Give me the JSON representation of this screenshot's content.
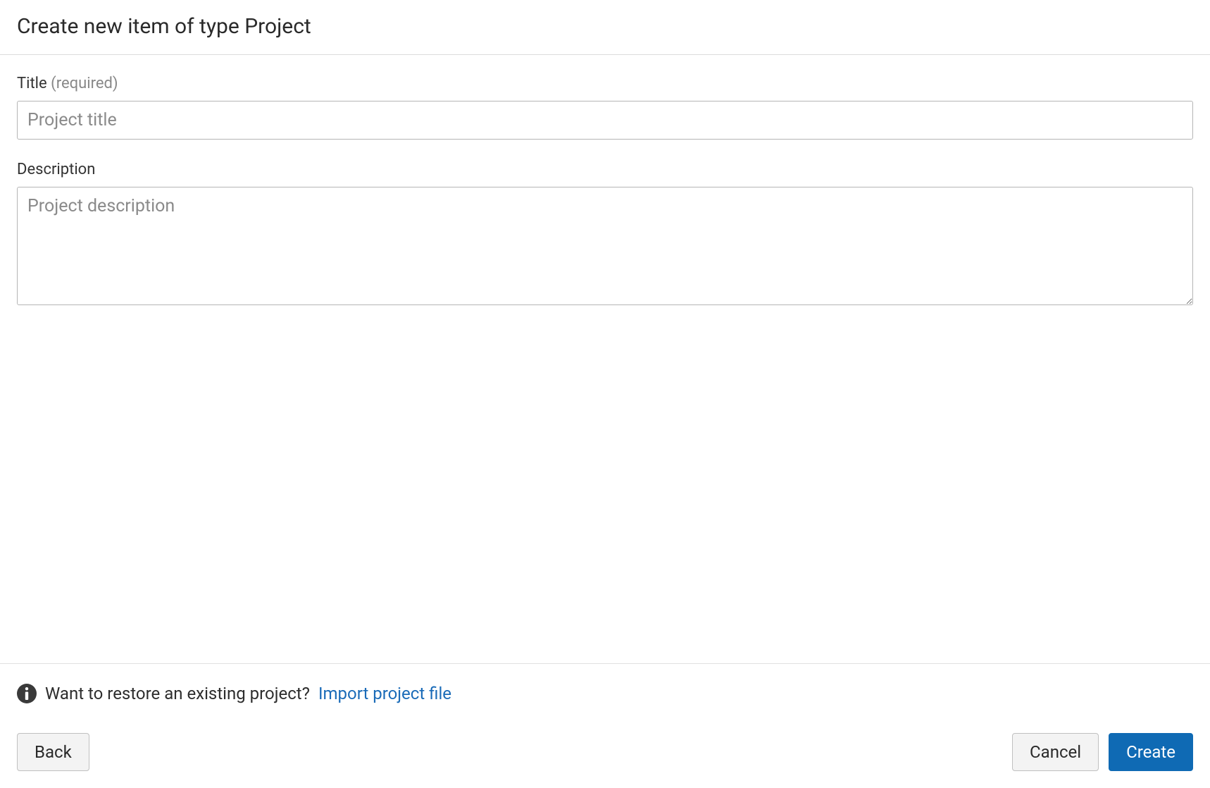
{
  "header": {
    "title": "Create new item of type Project"
  },
  "form": {
    "title": {
      "label": "Title",
      "required_hint": "(required)",
      "placeholder": "Project title",
      "value": ""
    },
    "description": {
      "label": "Description",
      "placeholder": "Project description",
      "value": ""
    }
  },
  "footer": {
    "restore_question": "Want to restore an existing project?",
    "import_link_label": "Import project file"
  },
  "buttons": {
    "back": "Back",
    "cancel": "Cancel",
    "create": "Create"
  }
}
